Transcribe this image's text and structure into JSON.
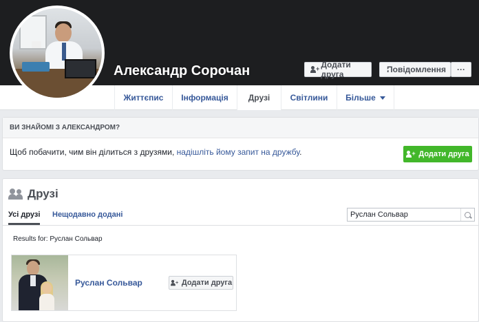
{
  "profile": {
    "name": "Александр Сорочан",
    "add_friend_label": "Додати друга",
    "message_label": "Повідомлення",
    "more_label": "···"
  },
  "nav": {
    "tabs": [
      {
        "label": "Життєпис"
      },
      {
        "label": "Інформація"
      },
      {
        "label": "Друзі"
      },
      {
        "label": "Світлини"
      },
      {
        "label": "Більше"
      }
    ],
    "active": "Друзі"
  },
  "know_card": {
    "heading": "ВИ ЗНАЙОМІ З АЛЕКСАНДРОМ?",
    "text_prefix": "Щоб побачити, чим він ділиться з друзями, ",
    "text_link": "надішліть йому запит на дружбу",
    "text_suffix": ".",
    "button_label": "Додати друга"
  },
  "friends": {
    "title": "Друзі",
    "tabs": {
      "all": "Усі друзі",
      "recent": "Нещодавно додані"
    },
    "search_value": "Руслан Сольвар",
    "results_label": "Results for: Руслан Сольвар",
    "results": [
      {
        "name": "Руслан Сольвар",
        "button_label": "Додати друга"
      }
    ]
  },
  "colors": {
    "cover": "#1d1e20",
    "link": "#365899",
    "green": "#42b72a",
    "background": "#e9ebee"
  }
}
